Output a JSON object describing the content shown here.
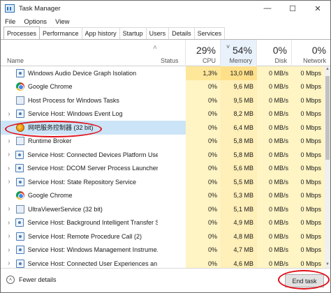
{
  "window": {
    "title": "Task Manager",
    "controls": {
      "minimize": "—",
      "maximize": "☐",
      "close": "✕"
    }
  },
  "menu": [
    "File",
    "Options",
    "View"
  ],
  "tabs": [
    "Processes",
    "Performance",
    "App history",
    "Startup",
    "Users",
    "Details",
    "Services"
  ],
  "active_tab": "Processes",
  "columns": {
    "name": "Name",
    "status": "Status",
    "cpu": {
      "percent": "29%",
      "label": "CPU"
    },
    "memory": {
      "percent": "54%",
      "label": "Memory"
    },
    "disk": {
      "percent": "0%",
      "label": "Disk"
    },
    "network": {
      "percent": "0%",
      "label": "Network"
    }
  },
  "rows": [
    {
      "expand": "",
      "icon": "gear",
      "name": "Windows Audio Device Graph Isolation",
      "status": "",
      "cpu": "1,3%",
      "memory": "13,0 MB",
      "disk": "0 MB/s",
      "network": "0 Mbps"
    },
    {
      "expand": "",
      "icon": "chrome",
      "name": "Google Chrome",
      "status": "",
      "cpu": "0%",
      "memory": "9,6 MB",
      "disk": "0 MB/s",
      "network": "0 Mbps"
    },
    {
      "expand": "",
      "icon": "sys",
      "name": "Host Process for Windows Tasks",
      "status": "",
      "cpu": "0%",
      "memory": "9,5 MB",
      "disk": "0 MB/s",
      "network": "0 Mbps"
    },
    {
      "expand": "›",
      "icon": "gear",
      "name": "Service Host: Windows Event Log",
      "status": "",
      "cpu": "0%",
      "memory": "8,2 MB",
      "disk": "0 MB/s",
      "network": "0 Mbps"
    },
    {
      "expand": "",
      "icon": "orange",
      "name": "网吧服务控制器 (32 bit)",
      "status": "",
      "cpu": "0%",
      "memory": "6,4 MB",
      "disk": "0 MB/s",
      "network": "0 Mbps",
      "selected": true
    },
    {
      "expand": "›",
      "icon": "sys",
      "name": "Runtime Broker",
      "status": "",
      "cpu": "0%",
      "memory": "5,8 MB",
      "disk": "0 MB/s",
      "network": "0 Mbps"
    },
    {
      "expand": "›",
      "icon": "gear",
      "name": "Service Host: Connected Devices Platform User...",
      "status": "",
      "cpu": "0%",
      "memory": "5,8 MB",
      "disk": "0 MB/s",
      "network": "0 Mbps"
    },
    {
      "expand": "›",
      "icon": "gear",
      "name": "Service Host: DCOM Server Process Launcher (5)",
      "status": "",
      "cpu": "0%",
      "memory": "5,6 MB",
      "disk": "0 MB/s",
      "network": "0 Mbps"
    },
    {
      "expand": "›",
      "icon": "gear",
      "name": "Service Host: State Repository Service",
      "status": "",
      "cpu": "0%",
      "memory": "5,5 MB",
      "disk": "0 MB/s",
      "network": "0 Mbps"
    },
    {
      "expand": "",
      "icon": "chrome",
      "name": "Google Chrome",
      "status": "",
      "cpu": "0%",
      "memory": "5,3 MB",
      "disk": "0 MB/s",
      "network": "0 Mbps"
    },
    {
      "expand": "›",
      "icon": "sys",
      "name": "UltraViewerService (32 bit)",
      "status": "",
      "cpu": "0%",
      "memory": "5,1 MB",
      "disk": "0 MB/s",
      "network": "0 Mbps"
    },
    {
      "expand": "›",
      "icon": "gear",
      "name": "Service Host: Background Intelligent Transfer S...",
      "status": "",
      "cpu": "0%",
      "memory": "4,9 MB",
      "disk": "0 MB/s",
      "network": "0 Mbps"
    },
    {
      "expand": "›",
      "icon": "gear",
      "name": "Service Host: Remote Procedure Call (2)",
      "status": "",
      "cpu": "0%",
      "memory": "4,8 MB",
      "disk": "0 MB/s",
      "network": "0 Mbps"
    },
    {
      "expand": "›",
      "icon": "gear",
      "name": "Service Host: Windows Management Instrume...",
      "status": "",
      "cpu": "0%",
      "memory": "4,7 MB",
      "disk": "0 MB/s",
      "network": "0 Mbps"
    },
    {
      "expand": "›",
      "icon": "gear",
      "name": "Service Host: Connected User Experiences an...",
      "status": "",
      "cpu": "0%",
      "memory": "4,6 MB",
      "disk": "0 MB/s",
      "network": "0 Mbps"
    }
  ],
  "footer": {
    "fewer_details": "Fewer details",
    "end_task": "End task"
  },
  "colors": {
    "highlight": "#e0101a",
    "selected_row": "#cce4f7",
    "heat_light": "#fff4c4",
    "heat_mem": "#ffefb8"
  }
}
